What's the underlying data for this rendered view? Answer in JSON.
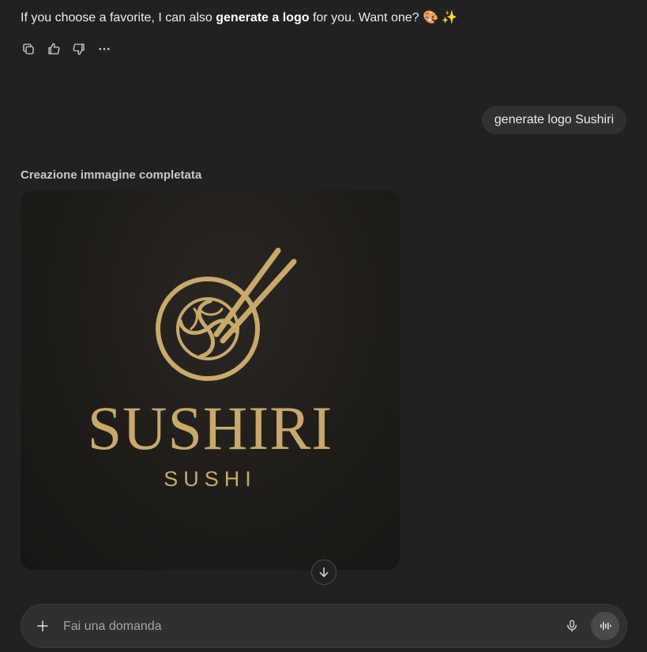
{
  "assistant_message": {
    "text_before": "If you choose a favorite, I can also ",
    "text_bold": "generate a logo",
    "text_after": " for you. Want one? ",
    "emoji": "🎨 ✨"
  },
  "message_actions": [
    {
      "icon": "copy-icon"
    },
    {
      "icon": "thumbs-up-icon"
    },
    {
      "icon": "thumbs-down-icon"
    },
    {
      "icon": "more-icon"
    }
  ],
  "user_message": "generate logo Sushiri",
  "image_status": "Creazione immagine completata",
  "generated_image": {
    "title": "SUSHIRI",
    "subtitle": "SUSHI"
  },
  "composer": {
    "placeholder": "Fai una domanda",
    "value": ""
  },
  "colors": {
    "background": "#212121",
    "bubble": "#303030",
    "gold": "#c9a96a"
  }
}
